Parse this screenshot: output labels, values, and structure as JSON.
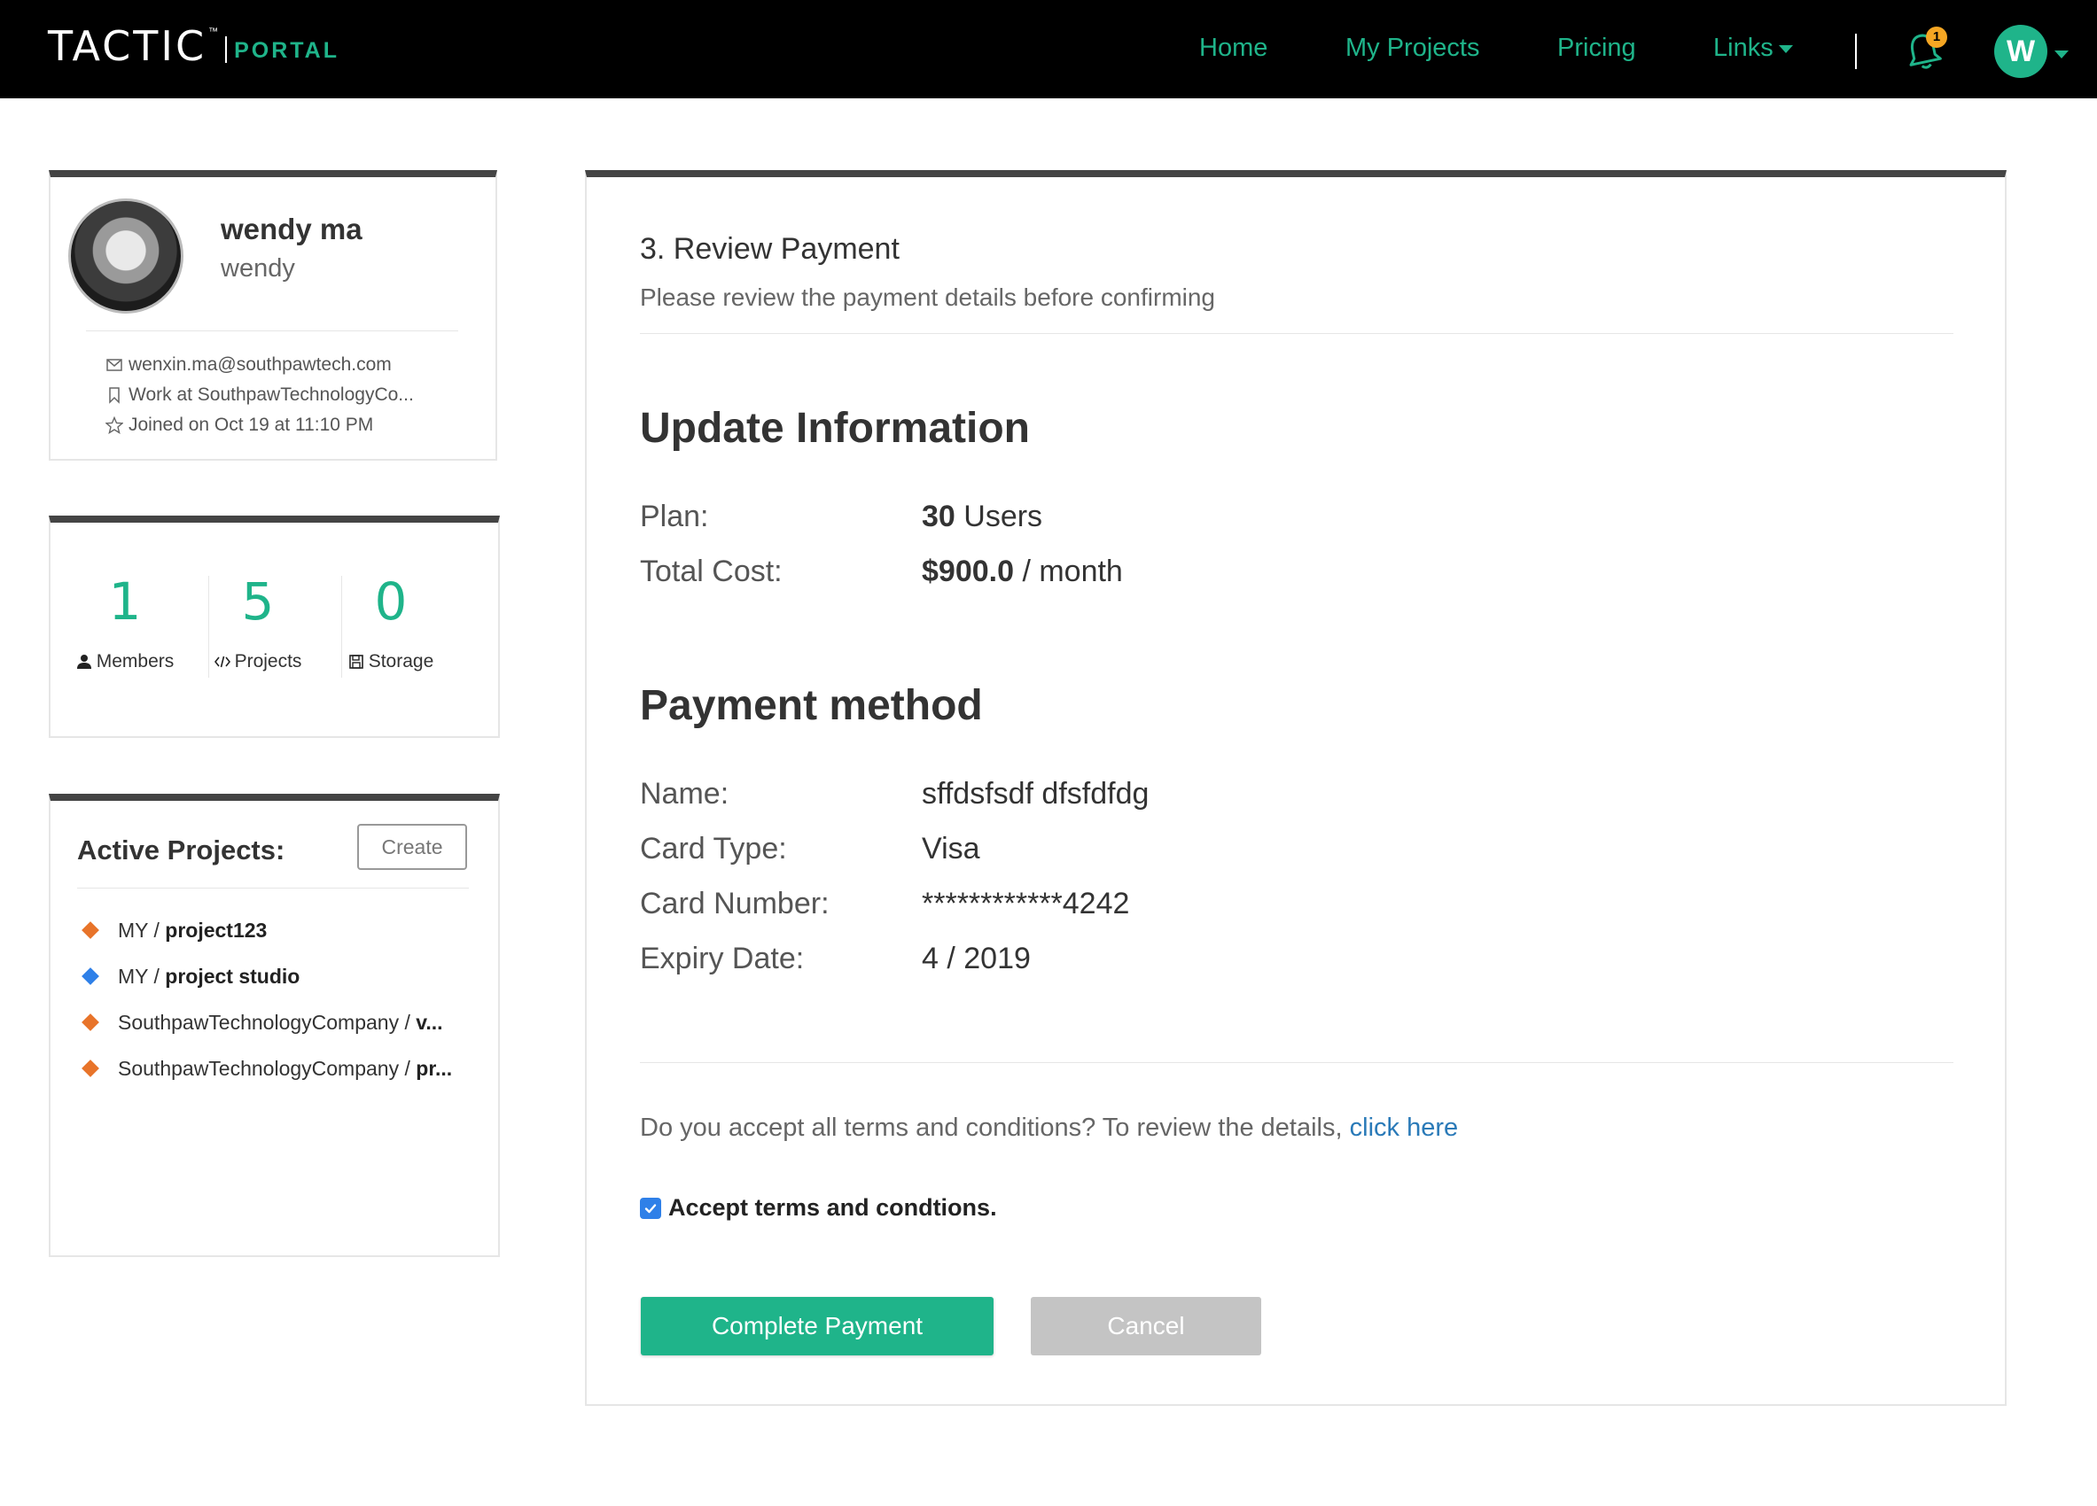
{
  "brand": {
    "name": "TACTIC",
    "tm": "™",
    "sub": "PORTAL"
  },
  "nav": {
    "home": "Home",
    "my_projects": "My Projects",
    "pricing": "Pricing",
    "links": "Links",
    "notification_count": "1",
    "user_initial": "W"
  },
  "colors": {
    "accent": "#1fb48a",
    "link": "#2a7ab8",
    "topbar": "#000000",
    "badge": "#f5a623",
    "checkbox": "#2f80e8",
    "cancel": "#c4c4c4"
  },
  "profile": {
    "name": "wendy ma",
    "username": "wendy",
    "email": "wenxin.ma@southpawtech.com",
    "work": "Work at SouthpawTechnologyCo...",
    "joined": "Joined on Oct 19 at 11:10 PM"
  },
  "stats": [
    {
      "value": "1",
      "label": "Members",
      "icon": "user-icon"
    },
    {
      "value": "5",
      "label": "Projects",
      "icon": "code-icon"
    },
    {
      "value": "0",
      "label": "Storage",
      "icon": "save-icon"
    }
  ],
  "projects_panel": {
    "title": "Active Projects:",
    "create_label": "Create",
    "items": [
      {
        "owner": "MY / ",
        "name": "project123",
        "color": "#e8742a"
      },
      {
        "owner": "MY / ",
        "name": "project studio",
        "color": "#2f80e8"
      },
      {
        "owner": "SouthpawTechnologyCompany / ",
        "name": "v...",
        "color": "#e8742a"
      },
      {
        "owner": "SouthpawTechnologyCompany / ",
        "name": "pr...",
        "color": "#e8742a"
      }
    ]
  },
  "review": {
    "step": "3. Review Payment",
    "subtitle": "Please review the payment details before confirming",
    "update_heading": "Update Information",
    "plan_label": "Plan:",
    "plan_value_bold": "30",
    "plan_value_rest": " Users",
    "cost_label": "Total Cost:",
    "cost_value_bold": "$900.0",
    "cost_value_rest": " / month",
    "payment_heading": "Payment method",
    "name_label": "Name:",
    "name_value": "sffdsfsdf dfsfdfdg",
    "card_type_label": "Card Type:",
    "card_type_value": "Visa",
    "card_number_label": "Card Number:",
    "card_number_value": "************4242",
    "expiry_label": "Expiry Date:",
    "expiry_value": "4 / 2019",
    "terms_text": "Do you accept all terms and conditions? To review the details, ",
    "terms_link": "click here",
    "accept_label": "Accept terms and condtions.",
    "accept_checked": true,
    "complete_label": "Complete Payment",
    "cancel_label": "Cancel"
  }
}
